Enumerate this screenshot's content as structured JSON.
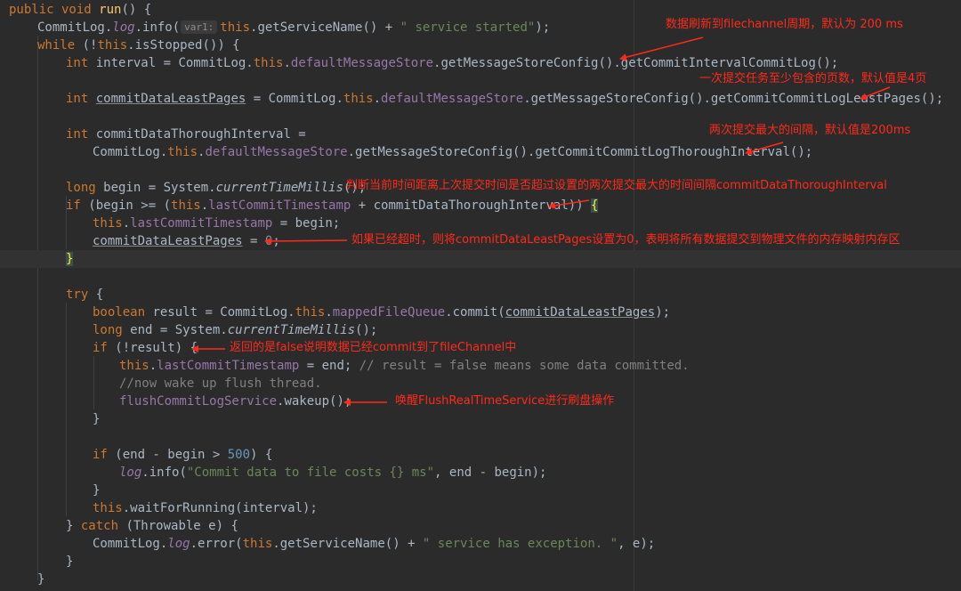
{
  "code": {
    "l01": {
      "a": "public void ",
      "b": "run",
      "c": "() {"
    },
    "l02": {
      "a": "CommitLog.",
      "b": "log",
      "c": ".info(",
      "hint": "var1:",
      "d": "this",
      "e": ".getServiceName() + ",
      "f": "\" service started\"",
      "g": ");"
    },
    "l03": {
      "a": "while",
      "b": " (!",
      "c": "this",
      "d": ".isStopped()) {"
    },
    "l04": {
      "a": "int",
      "b": " interval = CommitLog.",
      "c": "this",
      "d": ".",
      "e": "defaultMessageStore",
      "f": ".getMessageStoreConfig().getCommitIntervalCommitLog();"
    },
    "l05": {
      "a": "int",
      "b": "commitDataLeastPages",
      "c": " = CommitLog.",
      "d": "this",
      "e": ".",
      "f": "defaultMessageStore",
      "g": ".getMessageStoreConfig().getCommitCommitLogLeastPages();"
    },
    "l06": {
      "a": "int",
      "b": " commitDataThoroughInterval ="
    },
    "l07": {
      "a": "CommitLog.",
      "b": "this",
      "c": ".",
      "d": "defaultMessageStore",
      "e": ".getMessageStoreConfig().getCommitCommitLogThoroughInterval();"
    },
    "l08": {
      "a": "long",
      "b": " begin = System.",
      "c": "currentTimeMillis",
      "d": "();"
    },
    "l09": {
      "a": "if",
      "b": " (begin >= (",
      "c": "this",
      "d": ".",
      "e": "lastCommitTimestamp",
      "f": " + commitDataThoroughInterval)) ",
      "g": "{"
    },
    "l10": {
      "a": "this",
      "b": ".",
      "c": "lastCommitTimestamp",
      "d": " = begin;"
    },
    "l11": {
      "a": "commitDataLeastPages",
      "b": " = ",
      "c": "0",
      "d": ";"
    },
    "l12": {
      "a": "}"
    },
    "l13": {
      "a": "try",
      "b": " {"
    },
    "l14": {
      "a": "boolean",
      "b": " result = CommitLog.",
      "c": "this",
      "d": ".",
      "e": "mappedFileQueue",
      "f": ".commit(",
      "g": "commitDataLeastPages",
      "h": ");"
    },
    "l15": {
      "a": "long",
      "b": " end = System.",
      "c": "currentTimeMillis",
      "d": "();"
    },
    "l16": {
      "a": "if",
      "b": " (!result) {"
    },
    "l17": {
      "a": "this",
      "b": ".",
      "c": "lastCommitTimestamp",
      "d": " = end; ",
      "e": "// result = false means some data committed."
    },
    "l18": {
      "a": "//now wake up flush thread."
    },
    "l19": {
      "a": "flushCommitLogService",
      "b": ".wakeup();"
    },
    "l20": {
      "a": "}"
    },
    "l21": {
      "a": "if",
      "b": " (end - begin > ",
      "c": "500",
      "d": ") {"
    },
    "l22": {
      "a": "log",
      "b": ".info(",
      "c": "\"Commit data to file costs {} ms\"",
      "d": ", end - begin);"
    },
    "l23": {
      "a": "}"
    },
    "l24": {
      "a": "this",
      "b": ".waitForRunning(interval);"
    },
    "l25": {
      "a": "} ",
      "b": "catch",
      "c": " (Throwable e) {"
    },
    "l26": {
      "a": "CommitLog.",
      "b": "log",
      "c": ".error(",
      "d": "this",
      "e": ".getServiceName() + ",
      "f": "\" service has exception. \"",
      "g": ", e);"
    },
    "l27": {
      "a": "}"
    },
    "l28": {
      "a": "}"
    }
  },
  "annotations": {
    "a1": "数据刷新到filechannel周期，默认为 200 ms",
    "a2": "一次提交任务至少包含的页数，默认值是4页",
    "a3": "两次提交最大的间隔，默认值是200ms",
    "a4": "判断当前时间距离上次提交时间是否超过设置的两次提交最大的时间间隔commitDataThoroughInterval",
    "a5": "如果已经超时，则将commitDataLeastPages设置为0，表明将所有数据提交到物理文件的内存映射内存区",
    "a6": "返回的是false说明数据已经commit到了fileChannel中",
    "a7": "唤醒FlushRealTimeService进行刷盘操作"
  },
  "colors": {
    "background": "#2b2b2b",
    "keyword": "#cc7832",
    "field": "#9876aa",
    "method": "#ffc66d",
    "string": "#6a8759",
    "number": "#6897bb",
    "comment": "#808080",
    "annotation": "#ff2a1a"
  }
}
